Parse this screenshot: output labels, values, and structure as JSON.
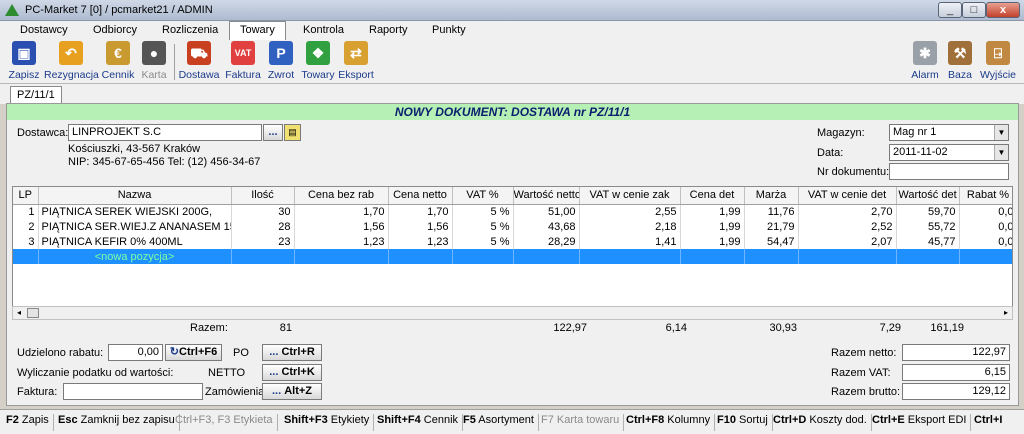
{
  "window": {
    "title": "PC-Market 7 [0] / pcmarket21 / ADMIN"
  },
  "menu": [
    "Dostawcy",
    "Odbiorcy",
    "Rozliczenia",
    "Towary",
    "Kontrola",
    "Raporty",
    "Punkty"
  ],
  "toolbar": {
    "zapisz": "Zapisz",
    "rezygnacja": "Rezygnacja",
    "cennik": "Cennik",
    "karta": "Karta",
    "dostawa": "Dostawa",
    "faktura": "Faktura",
    "zwrot": "Zwrot",
    "towary": "Towary",
    "eksport": "Eksport",
    "alarm": "Alarm",
    "baza": "Baza",
    "wyjscie": "Wyjście"
  },
  "doc_tab": "PZ/11/1",
  "banner": "NOWY DOKUMENT: DOSTAWA nr PZ/11/1",
  "supplier": {
    "label": "Dostawca:",
    "name": "LINPROJEKT S.C",
    "address": "Kościuszki, 43-567 Kraków",
    "nip": "NIP: 345-67-65-456 Tel: (12) 456-34-67",
    "dots": "..."
  },
  "right_fields": {
    "magazyn_label": "Magazyn:",
    "magazyn": "Mag nr 1",
    "data_label": "Data:",
    "data": "2011-11-02",
    "nr_label": "Nr dokumentu:",
    "nr": ""
  },
  "table": {
    "headers": [
      "LP",
      "Nazwa",
      "Ilość",
      "Cena bez rab",
      "Cena netto",
      "VAT %",
      "Wartość netto",
      "VAT w cenie zak",
      "Cena det",
      "Marża",
      "VAT w cenie det",
      "Wartość det",
      "Rabat %"
    ],
    "rows": [
      [
        "1",
        "PIĄTNICA SEREK WIEJSKI 200G,",
        "30",
        "1,70",
        "1,70",
        "5 %",
        "51,00",
        "2,55",
        "1,99",
        "11,76",
        "2,70",
        "59,70",
        "0,0"
      ],
      [
        "2",
        "PIĄTNICA SER.WIEJ.Z ANANASEM 150",
        "28",
        "1,56",
        "1,56",
        "5 %",
        "43,68",
        "2,18",
        "1,99",
        "21,79",
        "2,52",
        "55,72",
        "0,0"
      ],
      [
        "3",
        "PIĄTNICA KEFIR 0% 400ML",
        "23",
        "1,23",
        "1,23",
        "5 %",
        "28,29",
        "1,41",
        "1,99",
        "54,47",
        "2,07",
        "45,77",
        "0,0"
      ]
    ],
    "new_row": "<nowa pozycja>"
  },
  "totals_row": {
    "label": "Razem:",
    "ilosc": "81",
    "wartosc_netto": "122,97",
    "vat_zak": "6,14",
    "marza": "30,93",
    "vat_det": "7,29",
    "wartosc_det": "161,19"
  },
  "bottom": {
    "rabat_label": "Udzielono rabatu:",
    "rabat_value": "0,00",
    "rabat_btn": "Ctrl+F6",
    "po_label": "PO",
    "po_btn": "Ctrl+R",
    "wylicz_label": "Wyliczanie podatku od wartości:",
    "netto_label": "NETTO",
    "netto_btn": "Ctrl+K",
    "faktura_label": "Faktura:",
    "faktura_value": "",
    "zam_label": "Zamówienia:",
    "zam_btn": "Alt+Z",
    "dots": "..."
  },
  "summary": {
    "netto_label": "Razem netto:",
    "netto": "122,97",
    "vat_label": "Razem VAT:",
    "vat": "6,15",
    "brutto_label": "Razem brutto:",
    "brutto": "129,12"
  },
  "statusbar": [
    {
      "key": "F2",
      "label": "Zapis",
      "disabled": false
    },
    {
      "key": "Esc",
      "label": "Zamknij bez zapisu",
      "disabled": false
    },
    {
      "key": "Ctrl+F3, F3",
      "label": "Etykieta",
      "disabled": true
    },
    {
      "key": "Shift+F3",
      "label": "Etykiety",
      "disabled": false
    },
    {
      "key": "Shift+F4",
      "label": "Cennik",
      "disabled": false
    },
    {
      "key": "F5",
      "label": "Asortyment",
      "disabled": false
    },
    {
      "key": "F7",
      "label": "Karta towaru",
      "disabled": true
    },
    {
      "key": "Ctrl+F8",
      "label": "Kolumny",
      "disabled": false
    },
    {
      "key": "F10",
      "label": "Sortuj",
      "disabled": false
    },
    {
      "key": "Ctrl+D",
      "label": "Koszty dod.",
      "disabled": false
    },
    {
      "key": "Ctrl+E",
      "label": "Eksport EDI",
      "disabled": false
    },
    {
      "key": "Ctrl+I",
      "label": "",
      "disabled": false
    }
  ]
}
